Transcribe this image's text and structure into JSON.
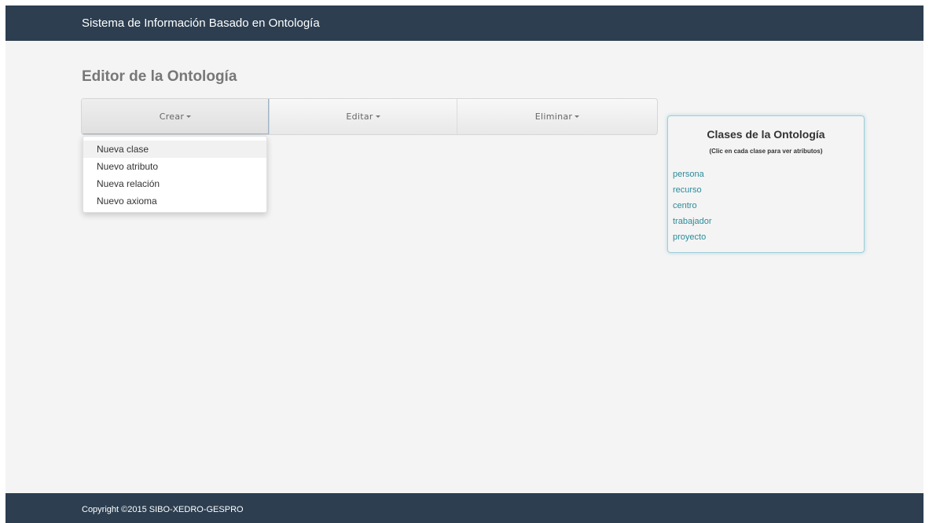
{
  "navbar": {
    "brand": "Sistema de Información Basado en Ontología"
  },
  "main": {
    "title": "Editor de la Ontología",
    "toolbar": {
      "buttons": [
        {
          "label": "Crear",
          "icon": "caret-down-icon"
        },
        {
          "label": "Editar",
          "icon": "caret-down-icon"
        },
        {
          "label": "Eliminar",
          "icon": "caret-down-icon"
        }
      ],
      "dropdown_items": [
        "Nueva clase",
        "Nuevo atributo",
        "Nueva relación",
        "Nuevo axioma"
      ]
    }
  },
  "panel": {
    "title": "Clases de la Ontología",
    "subtitle": "(Clic en cada clase para ver atributos)",
    "classes": [
      "persona",
      "recurso",
      "centro",
      "trabajador",
      "proyecto"
    ]
  },
  "footer": {
    "text": "Copyright ©2015 SIBO-XEDRO-GESPRO"
  },
  "colors": {
    "navbar": "#2c3e50",
    "background": "#f4f4f4",
    "link": "#2a8c9b",
    "panel_border": "#9ecfd9"
  }
}
